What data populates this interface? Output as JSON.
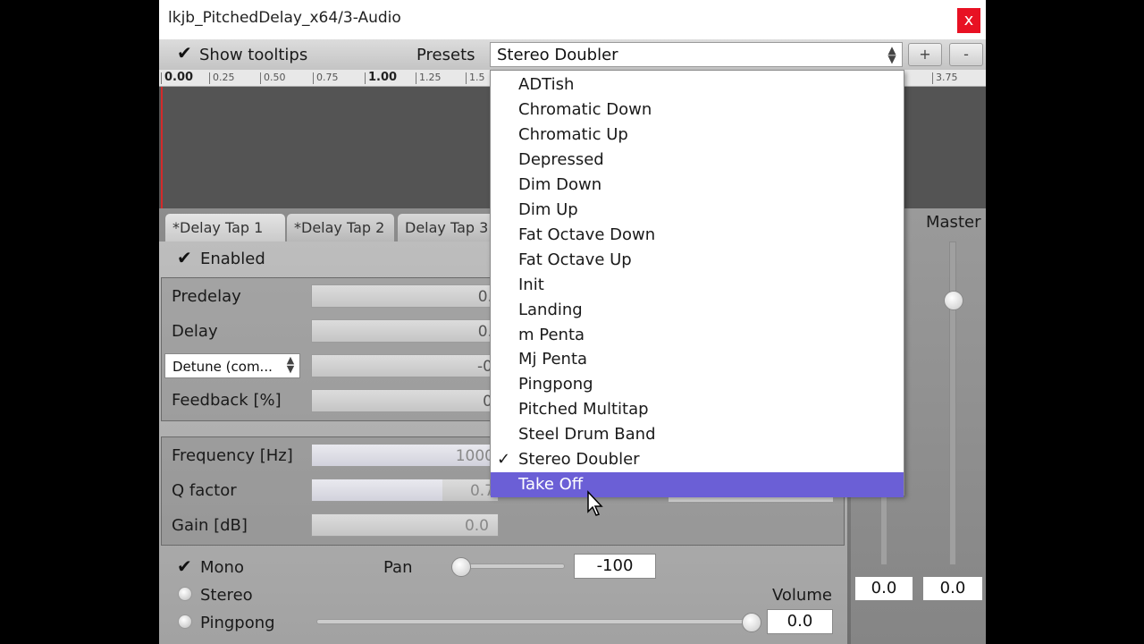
{
  "window": {
    "title": "lkjb_PitchedDelay_x64/3-Audio",
    "close_label": "x"
  },
  "toolbar": {
    "show_tooltips_label": "Show tooltips",
    "presets_label": "Presets",
    "preset_selected": "Stereo Doubler",
    "add_label": "+",
    "remove_label": "-"
  },
  "ruler": {
    "ticks": [
      "0.00",
      "0.25",
      "0.50",
      "0.75",
      "1.00",
      "1.25",
      "1.5",
      "3.75"
    ]
  },
  "tabs": [
    "*Delay Tap 1",
    "*Delay Tap 2",
    "Delay Tap 3"
  ],
  "tap": {
    "enabled_label": "Enabled",
    "predelay_label": "Predelay",
    "predelay_value": "0.",
    "delay_label": "Delay",
    "delay_value": "0.",
    "detune_mode": "Detune (com...",
    "detune_value": "-0",
    "feedback_label": "Feedback [%]",
    "feedback_value": "0",
    "frequency_label": "Frequency [Hz]",
    "frequency_value": "1000",
    "q_label": "Q factor",
    "q_value": "0.7",
    "gain_label": "Gain [dB]",
    "gain_value": "0.0",
    "mono_label": "Mono",
    "stereo_label": "Stereo",
    "pingpong_label": "Pingpong",
    "pan_label": "Pan",
    "pan_value": "-100",
    "volume_label": "Volume",
    "volume_value": "0.0"
  },
  "master": {
    "label": "Master",
    "left_value": "0.0",
    "right_value": "0.0"
  },
  "preset_list": {
    "items": [
      "ADTish",
      "Chromatic Down",
      "Chromatic Up",
      "Depressed",
      "Dim Down",
      "Dim Up",
      "Fat Octave Down",
      "Fat Octave Up",
      "Init",
      "Landing",
      "m Penta",
      "Mj Penta",
      "Pingpong",
      "Pitched Multitap",
      "Steel Drum Band",
      "Stereo Doubler",
      "Take Off"
    ],
    "checked_index": 15,
    "hover_index": 16,
    "check_glyph": "✓"
  },
  "colors": {
    "hover": "#6b5fd6",
    "close": "#e81123",
    "playhead": "#d42a2a"
  }
}
